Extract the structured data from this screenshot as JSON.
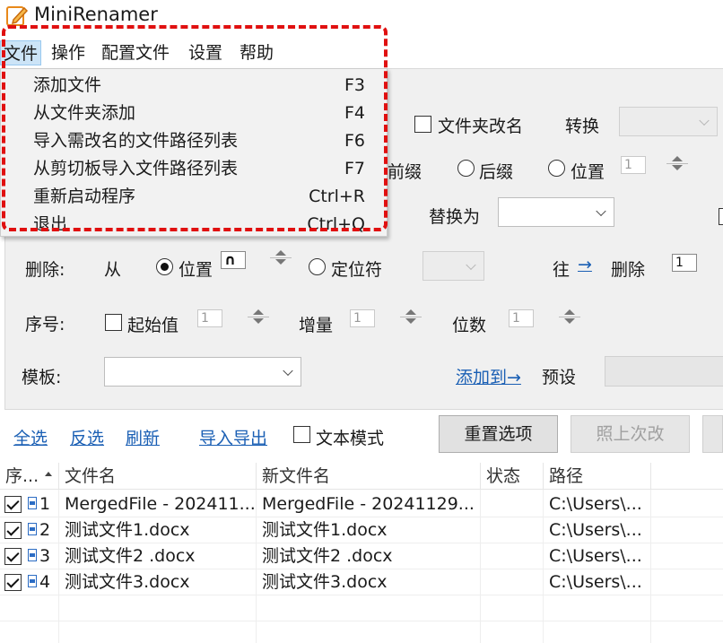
{
  "window": {
    "title": "MiniRenamer",
    "icon": "pencil-note-icon"
  },
  "menubar": {
    "items": [
      "文件",
      "操作",
      "配置文件",
      "设置",
      "帮助"
    ]
  },
  "file_menu": {
    "items": [
      {
        "label": "添加文件",
        "shortcut": "F3"
      },
      {
        "label": "从文件夹添加",
        "shortcut": "F4"
      },
      {
        "label": "导入需改名的文件路径列表",
        "shortcut": "F6"
      },
      {
        "label": "从剪切板导入文件路径列表",
        "shortcut": "F7"
      },
      {
        "label": "重新启动程序",
        "shortcut": "Ctrl+R"
      },
      {
        "label": "退出",
        "shortcut": "Ctrl+Q"
      }
    ],
    "highlight_color": "#e01010"
  },
  "options": {
    "folder_rename_label": "文件夹改名",
    "convert_label": "转换",
    "prefix_label": "前缀",
    "suffix_label": "后缀",
    "position_label": "位置",
    "position_value": "1",
    "replace_with_label": "替换为",
    "delete_label": "删除:",
    "from_label": "从",
    "delete_position_label": "位置",
    "delete_position_value": "∩",
    "locator_label": "定位符",
    "direction_label": "往",
    "direction_arrow": "→",
    "delete_count_label": "删除",
    "delete_count_value": "1",
    "seq_label": "序号:",
    "start_value_label": "起始值",
    "start_value": "1",
    "increment_label": "增量",
    "increment_value": "1",
    "digits_label": "位数",
    "digits_value": "1",
    "template_label": "模板:",
    "add_to_label": "添加到→",
    "preset_label": "预设"
  },
  "toolbar": {
    "select_all": "全选",
    "invert": "反选",
    "refresh": "刷新",
    "import_export": "导入导出",
    "text_mode": "文本模式",
    "reset_options": "重置选项",
    "last_change": "照上次改"
  },
  "list": {
    "columns": [
      "序...",
      "文件名",
      "新文件名",
      "状态",
      "路径"
    ],
    "rows": [
      {
        "checked": true,
        "index": "1",
        "name": "MergedFile - 202411...",
        "new_name": "MergedFile - 20241129...",
        "status": "",
        "path": "C:\\Users\\..."
      },
      {
        "checked": true,
        "index": "2",
        "name": "测试文件1.docx",
        "new_name": "测试文件1.docx",
        "status": "",
        "path": "C:\\Users\\..."
      },
      {
        "checked": true,
        "index": "3",
        "name": "测试文件2 .docx",
        "new_name": "测试文件2 .docx",
        "status": "",
        "path": "C:\\Users\\..."
      },
      {
        "checked": true,
        "index": "4",
        "name": "测试文件3.docx",
        "new_name": "测试文件3.docx",
        "status": "",
        "path": "C:\\Users\\..."
      }
    ]
  },
  "colors": {
    "accent_link": "#1a5fb4",
    "menu_active": "#cce4f7",
    "panel_bg": "#f0f0f0"
  }
}
